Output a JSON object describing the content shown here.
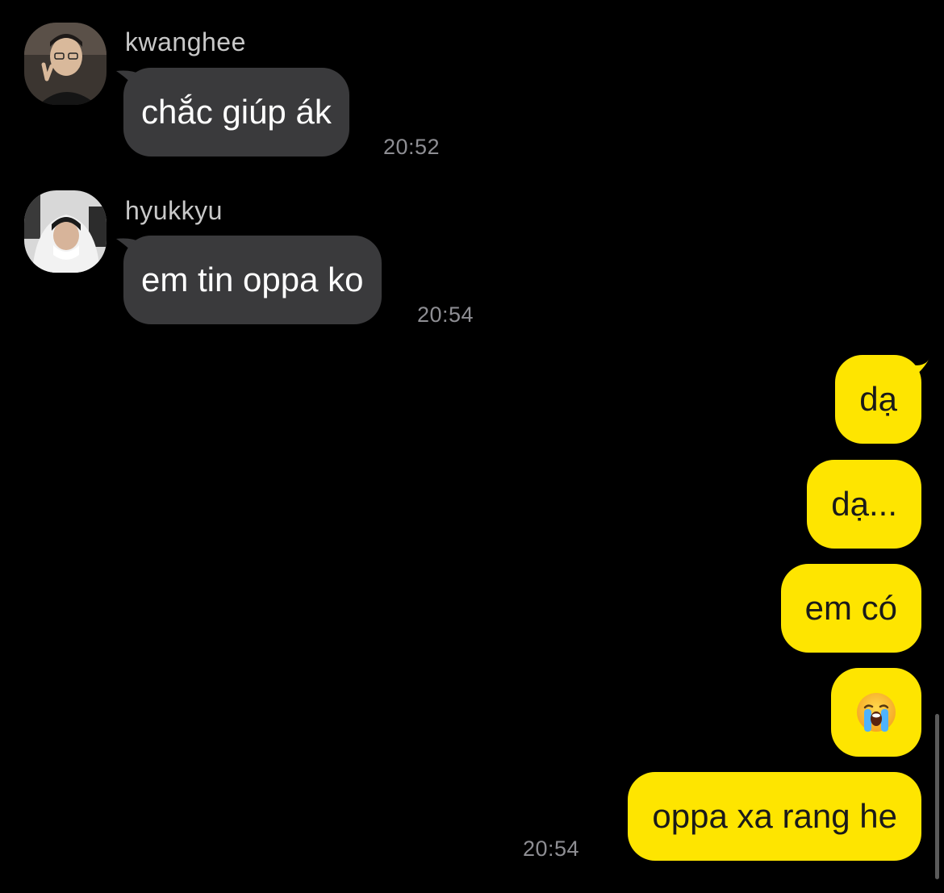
{
  "messages_in": [
    {
      "sender": "kwanghee",
      "text": "chắc giúp ák",
      "time": "20:52",
      "avatar_icon": "profile-photo-icon"
    },
    {
      "sender": "hyukkyu",
      "text": "em tin oppa ko",
      "time": "20:54",
      "avatar_icon": "profile-photo-icon"
    }
  ],
  "messages_out": [
    {
      "text": "dạ"
    },
    {
      "text": "dạ..."
    },
    {
      "text": "em có"
    },
    {
      "emoji": "loudly-crying-face-icon"
    },
    {
      "text": "oppa xa rang he",
      "time": "20:54"
    }
  ],
  "colors": {
    "background": "#000000",
    "incoming_bubble": "#3a3a3c",
    "outgoing_bubble": "#fee500",
    "timestamp": "#8e8e93",
    "sender_name": "#c8c8c8"
  }
}
